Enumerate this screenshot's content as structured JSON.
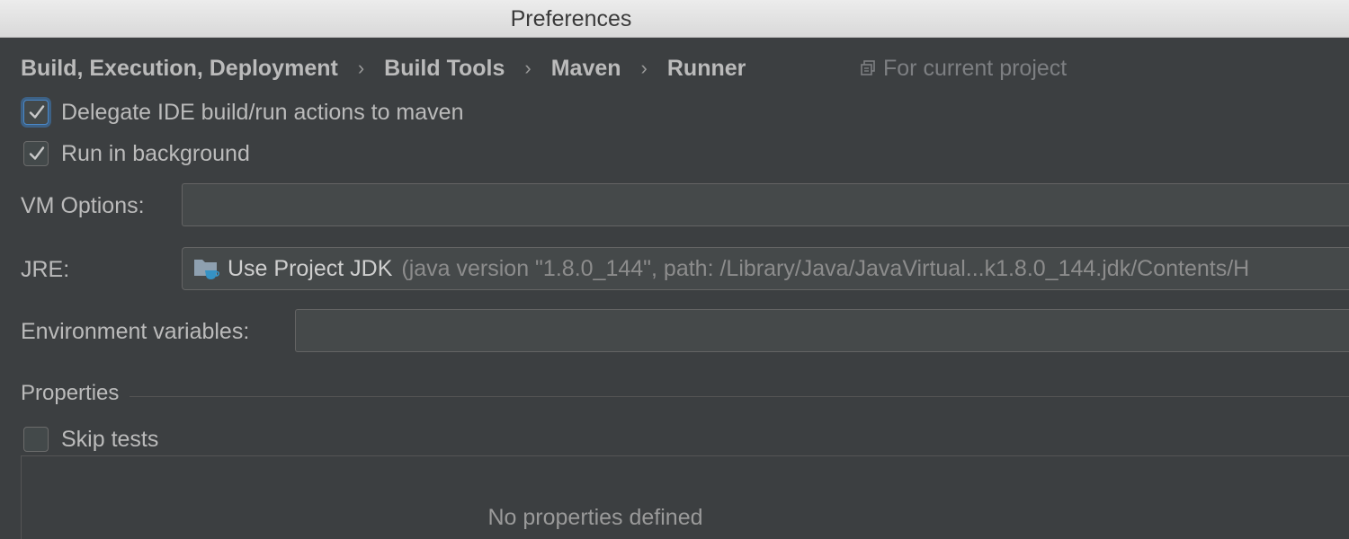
{
  "window": {
    "title": "Preferences"
  },
  "breadcrumb": {
    "items": [
      "Build, Execution, Deployment",
      "Build Tools",
      "Maven",
      "Runner"
    ],
    "separator": "›",
    "scope_label": "For current project"
  },
  "options": {
    "delegate": {
      "label": "Delegate IDE build/run actions to maven",
      "checked": true
    },
    "background": {
      "label": "Run in background",
      "checked": true
    }
  },
  "form": {
    "vm_options_label": "VM Options:",
    "vm_options_value": "",
    "jre_label": "JRE:",
    "jre_main": "Use Project JDK",
    "jre_detail": "(java version \"1.8.0_144\", path: /Library/Java/JavaVirtual...k1.8.0_144.jdk/Contents/H",
    "env_label": "Environment variables:",
    "env_value": ""
  },
  "properties": {
    "section_title": "Properties",
    "skip_tests": {
      "label": "Skip tests",
      "checked": false
    },
    "empty_text": "No properties defined"
  },
  "colors": {
    "background": "#3c3f41",
    "field": "#45494a",
    "focus": "#4a88c7",
    "text": "#bbbbbb",
    "muted": "#7d7f82"
  }
}
